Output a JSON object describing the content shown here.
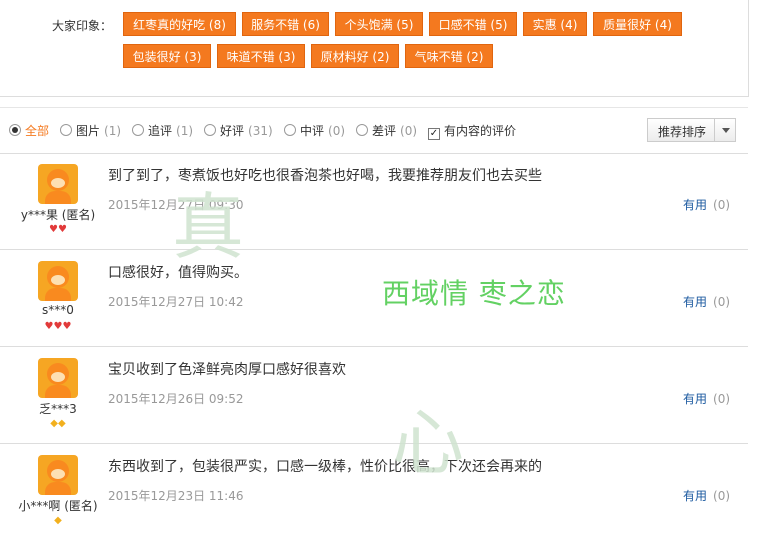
{
  "impressions": {
    "label": "大家印象：",
    "tags": [
      {
        "text": "红枣真的好吃 (8)"
      },
      {
        "text": "服务不错 (6)"
      },
      {
        "text": "个头饱满 (5)"
      },
      {
        "text": "口感不错 (5)"
      },
      {
        "text": "实惠 (4)"
      },
      {
        "text": "质量很好 (4)"
      },
      {
        "text": "包装很好 (3)"
      },
      {
        "text": "味道不错 (3)"
      },
      {
        "text": "原材料好 (2)"
      },
      {
        "text": "气味不错 (2)"
      }
    ]
  },
  "filters": [
    {
      "label": "全部",
      "count": "",
      "selected": true
    },
    {
      "label": "图片",
      "count": "(1)"
    },
    {
      "label": "追评",
      "count": "(1)"
    },
    {
      "label": "好评",
      "count": "(31)"
    },
    {
      "label": "中评",
      "count": "(0)"
    },
    {
      "label": "差评",
      "count": "(0)"
    },
    {
      "label": "有内容的评价",
      "count": "",
      "checked": true
    }
  ],
  "sort": {
    "label": "推荐排序"
  },
  "reviews": [
    {
      "user": "y***果 (匿名)",
      "content": "到了到了，枣煮饭也好吃也很香泡茶也好喝，我要推荐朋友们也去买些",
      "date": "2015年12月27日 09:30",
      "useful": "有用",
      "useful_count": "(0)",
      "badge": "heart",
      "badge_count": 2
    },
    {
      "user": "s***0",
      "content": "口感很好，值得购买。",
      "date": "2015年12月27日 10:42",
      "useful": "有用",
      "useful_count": "(0)",
      "badge": "heart",
      "badge_count": 3
    },
    {
      "user": "乏***3",
      "content": "宝贝收到了色泽鲜亮肉厚口感好很喜欢",
      "date": "2015年12月26日 09:52",
      "useful": "有用",
      "useful_count": "(0)",
      "badge": "gem",
      "badge_count": 2
    },
    {
      "user": "小***啊 (匿名)",
      "content": "东西收到了，包装很严实，口感一级棒，性价比很高，下次还会再来的",
      "date": "2015年12月23日 11:46",
      "useful": "有用",
      "useful_count": "(0)",
      "badge": "gem",
      "badge_count": 1
    }
  ],
  "watermark": {
    "char1": "真",
    "slogan": "西域情 枣之恋",
    "char2": "心"
  },
  "colors": {
    "accent": "#f4791f",
    "link": "#1c5aa0",
    "heart": "#e23a3a",
    "gem": "#f2b01e"
  }
}
